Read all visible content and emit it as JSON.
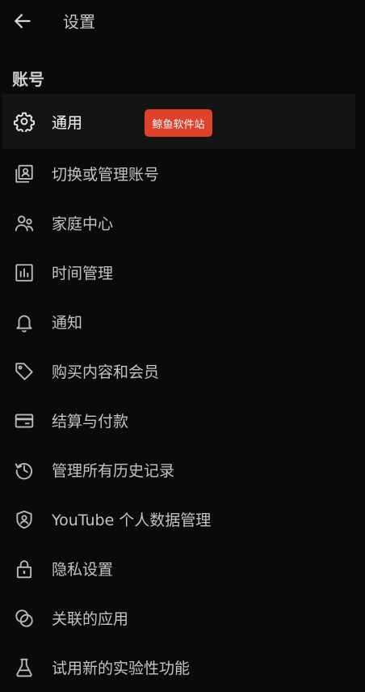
{
  "header": {
    "back_icon": "arrow-left-icon",
    "title": "设置"
  },
  "section": {
    "title": "账号"
  },
  "items": [
    {
      "label": "通用",
      "icon": "gear-icon"
    },
    {
      "label": "切换或管理账号",
      "icon": "account-switch-icon"
    },
    {
      "label": "家庭中心",
      "icon": "family-icon"
    },
    {
      "label": "时间管理",
      "icon": "time-stats-icon"
    },
    {
      "label": "通知",
      "icon": "bell-icon"
    },
    {
      "label": "购买内容和会员",
      "icon": "tag-icon"
    },
    {
      "label": "结算与付款",
      "icon": "credit-card-icon"
    },
    {
      "label": "管理所有历史记录",
      "icon": "history-icon"
    },
    {
      "label": "YouTube 个人数据管理",
      "icon": "shield-person-icon"
    },
    {
      "label": "隐私设置",
      "icon": "lock-icon"
    },
    {
      "label": "关联的应用",
      "icon": "linked-apps-icon"
    },
    {
      "label": "试用新的实验性功能",
      "icon": "flask-icon"
    }
  ],
  "watermark": {
    "text": "鲸鱼软件站",
    "color": "#e0412a"
  }
}
